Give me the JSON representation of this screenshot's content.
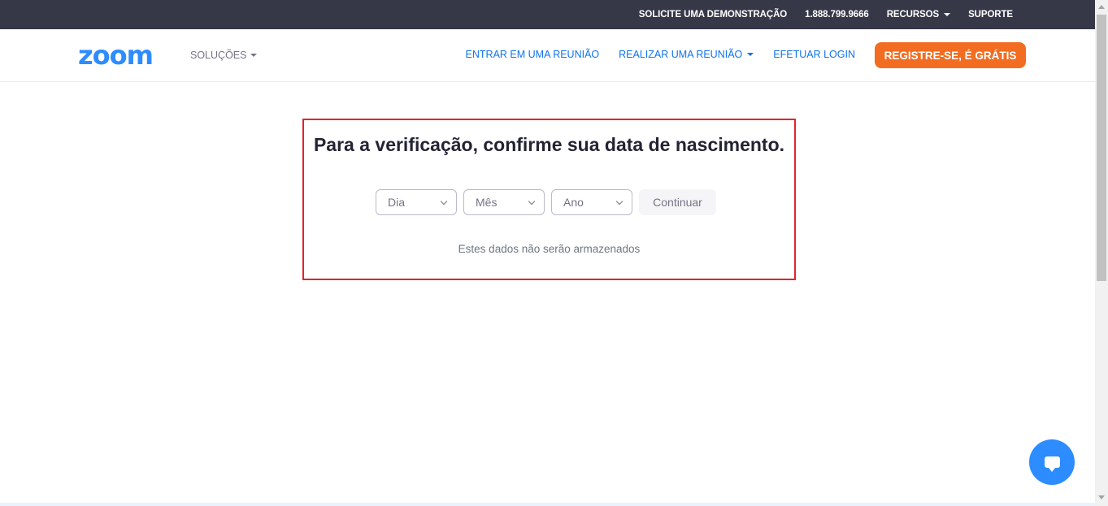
{
  "topbar": {
    "demo": "SOLICITE UMA DEMONSTRAÇÃO",
    "phone": "1.888.799.9666",
    "resources": "RECURSOS",
    "support": "SUPORTE"
  },
  "nav": {
    "logo": "zoom",
    "solutions": "SOLUÇÕES",
    "join": "ENTRAR EM UMA REUNIÃO",
    "host": "REALIZAR UMA REUNIÃO",
    "login": "EFETUAR LOGIN",
    "signup": "REGISTRE-SE, É GRÁTIS"
  },
  "verification": {
    "heading": "Para a verificação, confirme sua data de nascimento.",
    "day_placeholder": "Dia",
    "month_placeholder": "Mês",
    "year_placeholder": "Ano",
    "continue_label": "Continuar",
    "note": "Estes dados não serão armazenados"
  },
  "colors": {
    "brand_blue": "#2d8cff",
    "link_blue": "#0e72ed",
    "signup_orange": "#f26d21",
    "topbar_bg": "#363848",
    "highlight_red": "#e0242f"
  },
  "icons": {
    "chat": "chat-bubble-icon",
    "dropdown": "chevron-down-icon",
    "caret": "caret-down-icon"
  }
}
